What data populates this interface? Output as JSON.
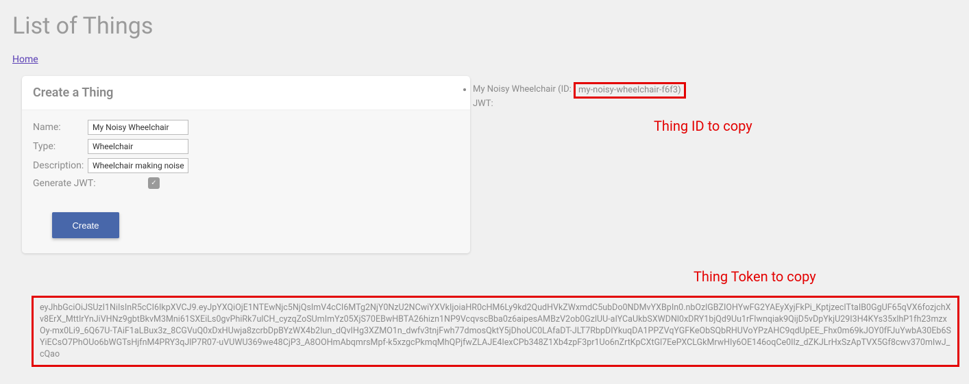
{
  "page": {
    "title": "List of Things",
    "breadcrumb_home": "Home"
  },
  "form": {
    "header": "Create a Thing",
    "labels": {
      "name": "Name:",
      "type": "Type:",
      "description": "Description:",
      "generate_jwt": "Generate JWT:"
    },
    "values": {
      "name": "My Noisy Wheelchair",
      "type": "Wheelchair",
      "description": "Wheelchair making noise!"
    },
    "generate_jwt_checked": true,
    "create_label": "Create"
  },
  "thing": {
    "name": "My Noisy Wheelchair",
    "id_prefix": " (ID: ",
    "id": "my-noisy-wheelchair-f6f3)",
    "jwt_label": "JWT:"
  },
  "annotations": {
    "thing_id": "Thing ID to copy",
    "thing_token": "Thing Token to copy"
  },
  "token": "eyJhbGciOiJSUzI1NiIsInR5cCI6IkpXVCJ9.eyJpYXQiOjE1NTEwNjc5NjQsImV4cCI6MTg2NjY0NzU2NCwiYXVkIjoiaHR0cHM6Ly9kd2QudHVkZWxmdC5ubDo0NDMvYXBpIn0.nbOzlGBZIOHYwFG2YAEyXyjFkPi_KptjzeclTtaIB0GgUF65qVX6fozjchXv8ErX_MttIrYnJiVHNz9gbtBkvM3Mni61SXEiLs0gvPhiRk7ulCH_cyzqZoSUmImYz05XjS70EBwHBTA26hizn1NP9VcqvscBba0z6aipesAMBzV2ob0GzlUU-aIYCaUkbSXWDNl0xDRY1bjQd9Uu1rFIwnqiak9QijD5vDpYkjU29I3H4KYs35xlhP1fh23mzxOy-mx0Li9_6Q67U-TAiF1aLBux3z_8CGVuQ0xDxHUwja8zcrbDpBYzWX4b2Iun_dQvIHg3XZMO1n_dwfv3tnjFwh77dmosQktY5jDhoUC0LAfaDT-JLT7RbpDIYkuqDA1PPZVqYGFKeObSQbRHUVoYPzAHC9qdUpEE_Fhx0m69kJOY0fFJuYwbA30Eb6SYiECsO7PhOUo6bWGTsHjfnM4PRY3qJlP7R07-uVUWU369we48CjP3_A8OOHmAbqmrsMpf-k5xzgcPkmqMhQPjfwZLAJE4IexCPb348Z1Xb4zpF3pr1Uo6nZrtKpCXtGl7EePXCLGkMrwHIy6OE146oqCe0Ilz_dZKJLrHxSzApTVX5Gf8cwv370mIwJ_cQao"
}
